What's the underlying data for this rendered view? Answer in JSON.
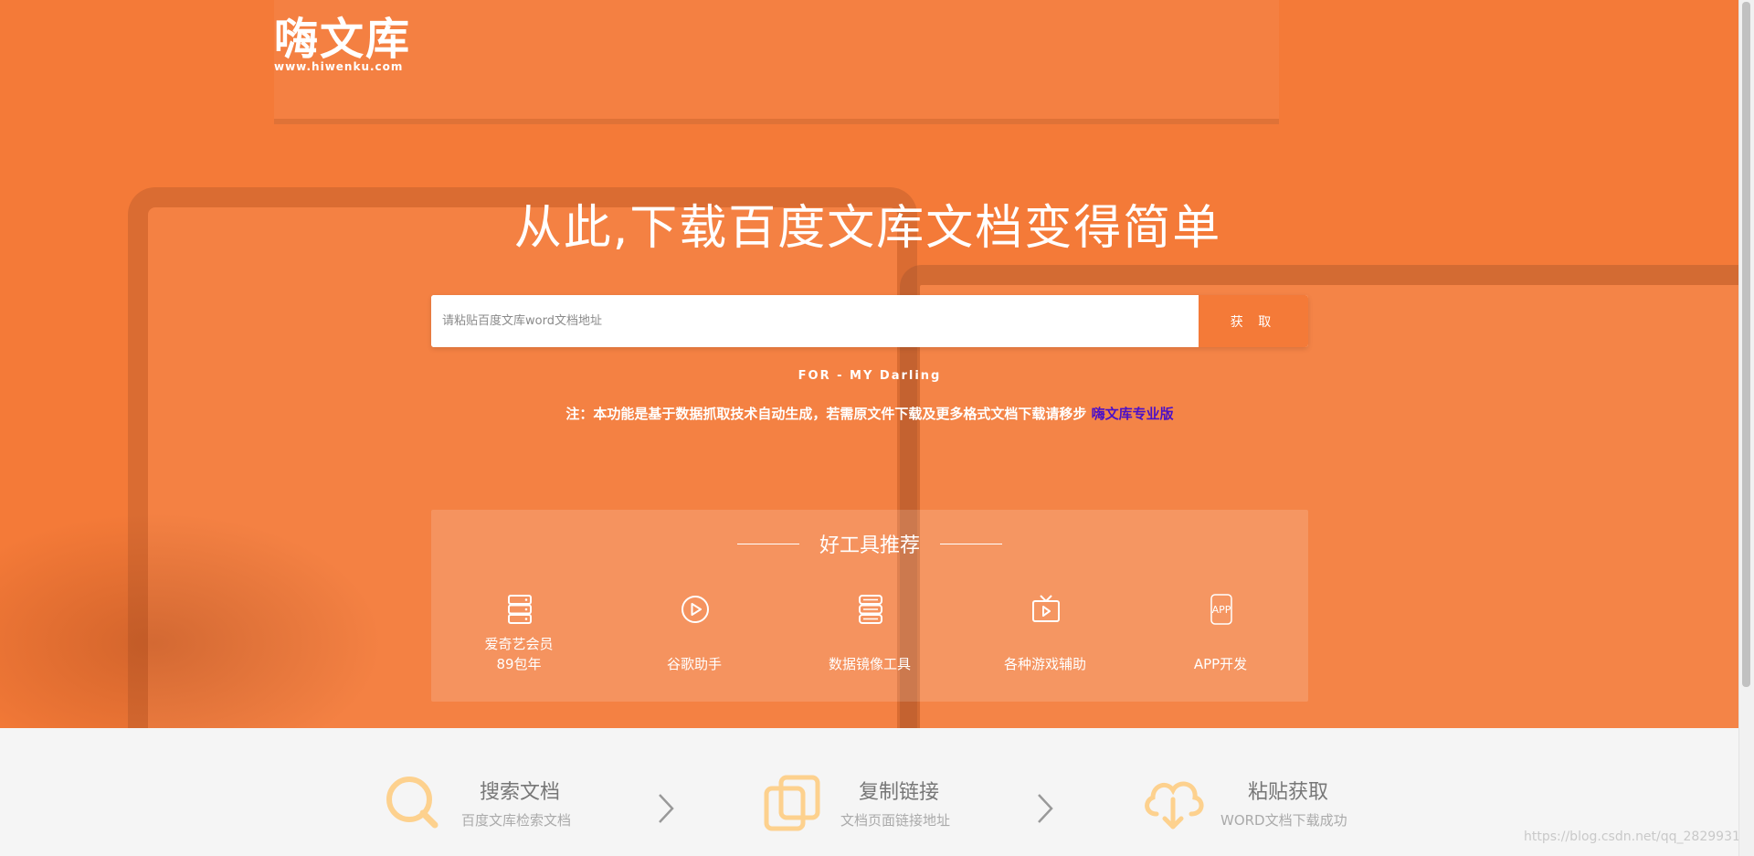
{
  "logo": {
    "text": "嗨文库",
    "url_text": "www.hiwenku.com"
  },
  "hero": {
    "headline": "从此,下载百度文库文档变得简单",
    "search": {
      "placeholder": "请粘贴百度文库word文档地址",
      "value": "",
      "button_label": "获 取"
    },
    "dedication": "FOR - MY Darling",
    "notice_text": "注：本功能是基于数据抓取技术自动生成，若需原文件下载及更多格式文档下载请移步",
    "notice_link": "嗨文库专业版"
  },
  "tools": {
    "title": "好工具推荐",
    "items": [
      {
        "icon": "server-stack-icon",
        "label_line1": "爱奇艺会员",
        "label_line2": "89包年"
      },
      {
        "icon": "play-circle-icon",
        "label_line1": "",
        "label_line2": "谷歌助手"
      },
      {
        "icon": "database-icon",
        "label_line1": "",
        "label_line2": "数据镜像工具"
      },
      {
        "icon": "tv-play-icon",
        "label_line1": "",
        "label_line2": "各种游戏辅助"
      },
      {
        "icon": "app-icon",
        "icon_text": "APP",
        "label_line1": "",
        "label_line2": "APP开发"
      }
    ]
  },
  "steps": [
    {
      "icon": "search-icon",
      "title": "搜索文档",
      "desc": "百度文库检索文档"
    },
    {
      "icon": "copy-icon",
      "title": "复制链接",
      "desc": "文档页面链接地址"
    },
    {
      "icon": "cloud-download-icon",
      "title": "粘贴获取",
      "desc": "WORD文档下载成功"
    }
  ],
  "watermark": "https://blog.csdn.net/qq_28299311",
  "colors": {
    "brand_orange": "#f47a38",
    "step_icon": "#fdd18e",
    "link_purple": "#4b10c8"
  }
}
